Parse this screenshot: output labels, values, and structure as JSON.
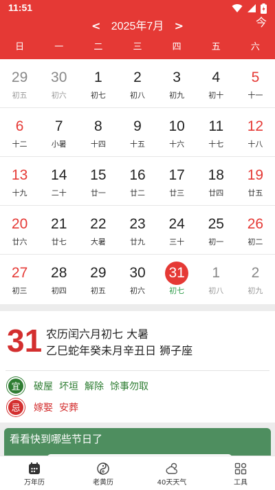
{
  "status_bar": {
    "time": "11:51"
  },
  "header": {
    "prev_arrow": "<",
    "month_title": "2025年7月",
    "next_arrow": ">",
    "today_button": "今",
    "weekdays": [
      "日",
      "一",
      "二",
      "三",
      "四",
      "五",
      "六"
    ]
  },
  "colors": {
    "accent": "#e53935",
    "good": "#2e7d32",
    "bad": "#d32f2f",
    "banner": "#4e8e5f"
  },
  "calendar": {
    "weeks": [
      [
        {
          "day": "29",
          "lunar": "初五",
          "other": true
        },
        {
          "day": "30",
          "lunar": "初六",
          "other": true
        },
        {
          "day": "1",
          "lunar": "初七"
        },
        {
          "day": "2",
          "lunar": "初八"
        },
        {
          "day": "3",
          "lunar": "初九"
        },
        {
          "day": "4",
          "lunar": "初十"
        },
        {
          "day": "5",
          "lunar": "十一"
        }
      ],
      [
        {
          "day": "6",
          "lunar": "十二"
        },
        {
          "day": "7",
          "lunar": "小暑"
        },
        {
          "day": "8",
          "lunar": "十四"
        },
        {
          "day": "9",
          "lunar": "十五"
        },
        {
          "day": "10",
          "lunar": "十六"
        },
        {
          "day": "11",
          "lunar": "十七"
        },
        {
          "day": "12",
          "lunar": "十八"
        }
      ],
      [
        {
          "day": "13",
          "lunar": "十九"
        },
        {
          "day": "14",
          "lunar": "二十"
        },
        {
          "day": "15",
          "lunar": "廿一"
        },
        {
          "day": "16",
          "lunar": "廿二"
        },
        {
          "day": "17",
          "lunar": "廿三"
        },
        {
          "day": "18",
          "lunar": "廿四"
        },
        {
          "day": "19",
          "lunar": "廿五"
        }
      ],
      [
        {
          "day": "20",
          "lunar": "廿六"
        },
        {
          "day": "21",
          "lunar": "廿七"
        },
        {
          "day": "22",
          "lunar": "大暑"
        },
        {
          "day": "23",
          "lunar": "廿九"
        },
        {
          "day": "24",
          "lunar": "三十"
        },
        {
          "day": "25",
          "lunar": "初一"
        },
        {
          "day": "26",
          "lunar": "初二"
        }
      ],
      [
        {
          "day": "27",
          "lunar": "初三"
        },
        {
          "day": "28",
          "lunar": "初四"
        },
        {
          "day": "29",
          "lunar": "初五"
        },
        {
          "day": "30",
          "lunar": "初六"
        },
        {
          "day": "31",
          "lunar": "初七",
          "today": true
        },
        {
          "day": "1",
          "lunar": "初八",
          "other": true
        },
        {
          "day": "2",
          "lunar": "初九",
          "other": true
        }
      ]
    ]
  },
  "detail": {
    "big_day": "31",
    "lunar_line1": "农历闰六月初七 大暑",
    "lunar_line2": "乙巳蛇年癸未月辛丑日  狮子座",
    "yi_label": "宜",
    "yi_items": [
      "破屋",
      "坏垣",
      "解除",
      "馀事勿取"
    ],
    "ji_label": "忌",
    "ji_items": [
      "嫁娶",
      "安葬"
    ]
  },
  "banner": {
    "text": "看看快到哪些节日了"
  },
  "bottom_nav": [
    {
      "label": "万年历",
      "icon": "calendar-icon"
    },
    {
      "label": "老黄历",
      "icon": "almanac-icon"
    },
    {
      "label": "40天天气",
      "icon": "weather-icon"
    },
    {
      "label": "工具",
      "icon": "tools-icon"
    }
  ]
}
